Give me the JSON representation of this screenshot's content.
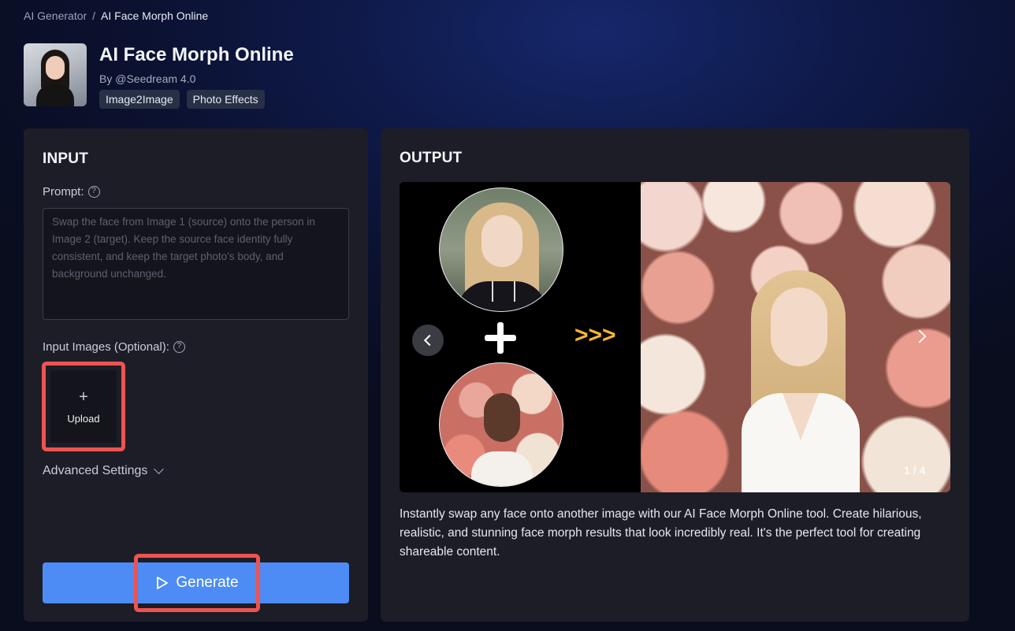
{
  "breadcrumb": {
    "root": "AI Generator",
    "separator": "/",
    "current": "AI Face Morph Online"
  },
  "header": {
    "title": "AI Face Morph Online",
    "byline": "By @Seedream 4.0",
    "tags": [
      "Image2Image",
      "Photo Effects"
    ]
  },
  "input": {
    "title": "INPUT",
    "prompt_label": "Prompt:",
    "prompt_placeholder": "Swap the face from Image 1 (source) onto the person in Image 2 (target). Keep the source face identity fully consistent, and keep the target photo’s body, and background unchanged.",
    "images_label": "Input Images (Optional):",
    "upload_plus": "+",
    "upload_label": "Upload",
    "advanced_label": "Advanced Settings",
    "generate_label": "Generate"
  },
  "output": {
    "title": "OUTPUT",
    "arrows": ">>>",
    "counter": "1 / 4",
    "description": "Instantly swap any face onto another image with our AI Face Morph Online tool. Create hilarious, realistic, and stunning face morph results that look incredibly real. It's the perfect tool for creating shareable content."
  },
  "colors": {
    "primary_button": "#4d8cf5",
    "highlight_border": "#ef5350",
    "arrow_accent": "#f7b733",
    "panel_bg": "#1c1d27"
  }
}
